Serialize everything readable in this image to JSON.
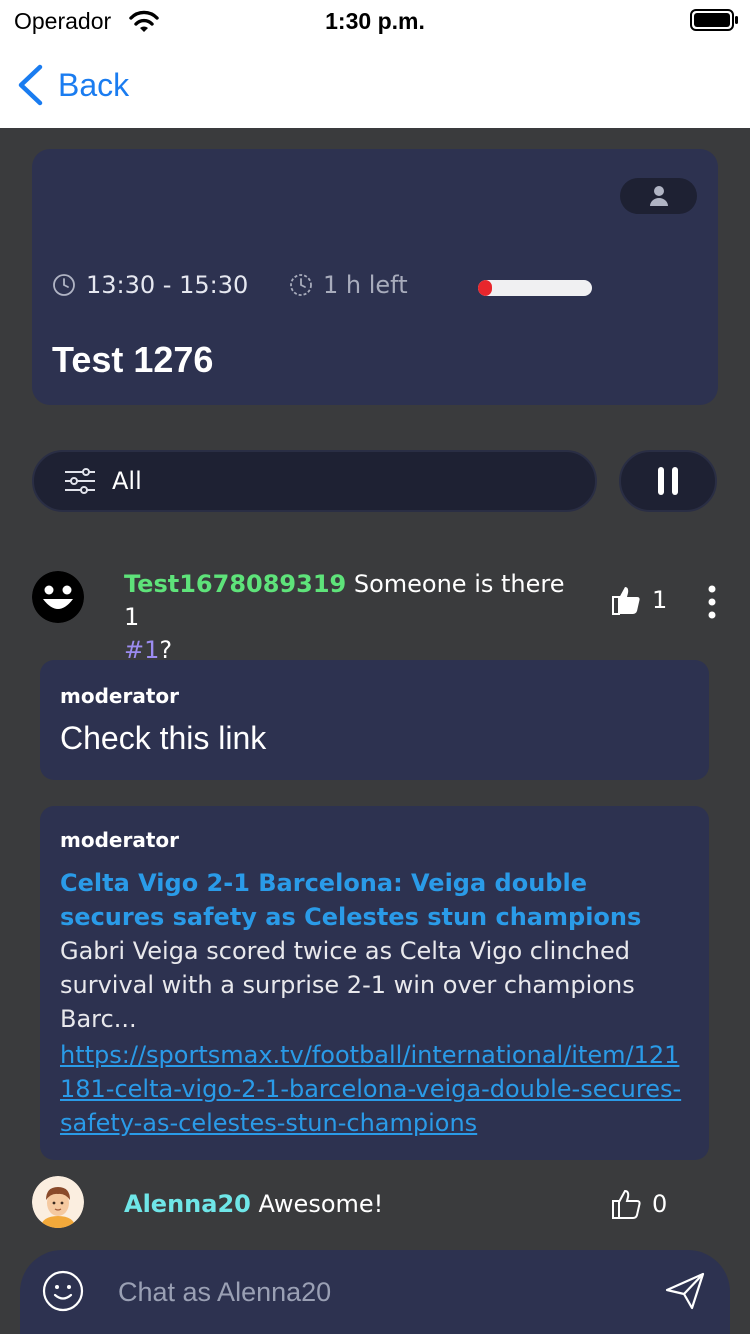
{
  "statusbar": {
    "carrier": "Operador",
    "time": "1:30 p.m."
  },
  "nav": {
    "back_label": "Back"
  },
  "event": {
    "time_range": "13:30 - 15:30",
    "time_left": "1 h left",
    "progress": 0.12,
    "title": "Test 1276"
  },
  "filter": {
    "label": "All"
  },
  "messages": [
    {
      "username": "Test1678089319",
      "text": " Someone is there 1",
      "tag": "#1",
      "tail": "?",
      "likes": "1",
      "username_color": "#5ee37a"
    },
    {
      "username": "Alenna20",
      "text": " Awesome!",
      "likes": "0",
      "username_color": "#6fe6e8"
    }
  ],
  "moderator_cards": [
    {
      "label": "moderator",
      "text": "Check this link"
    },
    {
      "label": "moderator",
      "link_title": "Celta Vigo 2-1 Barcelona: Veiga double secures safety as Celestes stun champions",
      "description": "Gabri Veiga scored twice as Celta Vigo clinched survival with a surprise 2-1 win over champions Barc...",
      "url": "https://sportsmax.tv/football/international/item/121181-celta-vigo-2-1-barcelona-veiga-double-secures-safety-as-celestes-stun-champions"
    }
  ],
  "composer": {
    "placeholder": "Chat as Alenna20"
  },
  "colors": {
    "accent": "#1a7cf0",
    "card": "#2d3250",
    "link": "#2a9be8",
    "progress": "#e8262c"
  }
}
